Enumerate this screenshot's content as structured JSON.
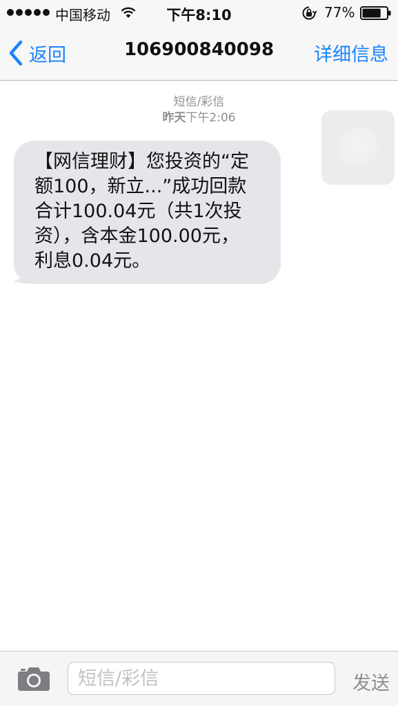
{
  "status_bar": {
    "carrier": "中国移动",
    "time": "下午8:10",
    "battery_percent": "77%",
    "battery_level": 0.77,
    "signal_bars": 5,
    "icons": [
      "wifi-icon",
      "rotation-lock-icon",
      "battery-icon"
    ]
  },
  "nav": {
    "back_label": "返回",
    "title": "106900840098",
    "details_label": "详细信息",
    "accent_color": "#1a84fb"
  },
  "thread": {
    "message_type": "短信/彩信",
    "timestamp_day": "昨天",
    "timestamp_time": "下午2:06",
    "messages": [
      {
        "direction": "incoming",
        "lines": [
          "【网信理财】您投资的“定",
          "额100，新立...”成功回款",
          "合计100.04元（共1次投",
          "资），含本金100.00元，",
          "利息0.04元。"
        ]
      }
    ],
    "bubble_color": "#e5e5ea"
  },
  "input_bar": {
    "placeholder": "短信/彩信",
    "send_label": "发送",
    "camera_icon": "camera-icon"
  }
}
